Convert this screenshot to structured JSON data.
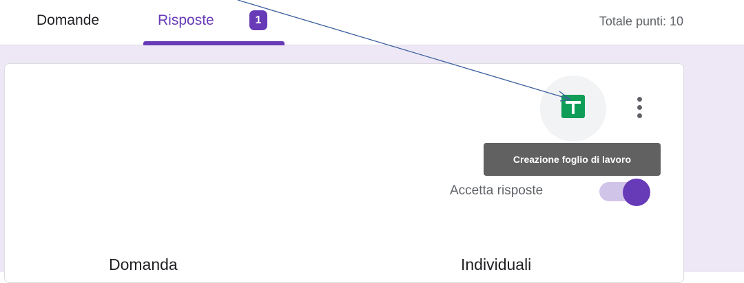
{
  "tabs": {
    "domande_label": "Domande",
    "risposte_label": "Risposte",
    "risposte_badge": "1"
  },
  "header": {
    "total_points": "Totale punti: 10"
  },
  "toolbar": {
    "sheets_icon": "google-sheets-icon",
    "more_icon": "more-vert-icon",
    "tooltip": "Creazione foglio di lavoro"
  },
  "responses": {
    "accept_label": "Accetta risposte",
    "accepting": true
  },
  "summary_tabs": {
    "question_label": "Domanda",
    "individual_label": "Individuali"
  },
  "colors": {
    "accent": "#673ab7",
    "accent_light": "#d1c4e9",
    "background": "#ede7f6",
    "sheets_green": "#0f9d58",
    "annotation_arrow": "#3a5f9e"
  }
}
